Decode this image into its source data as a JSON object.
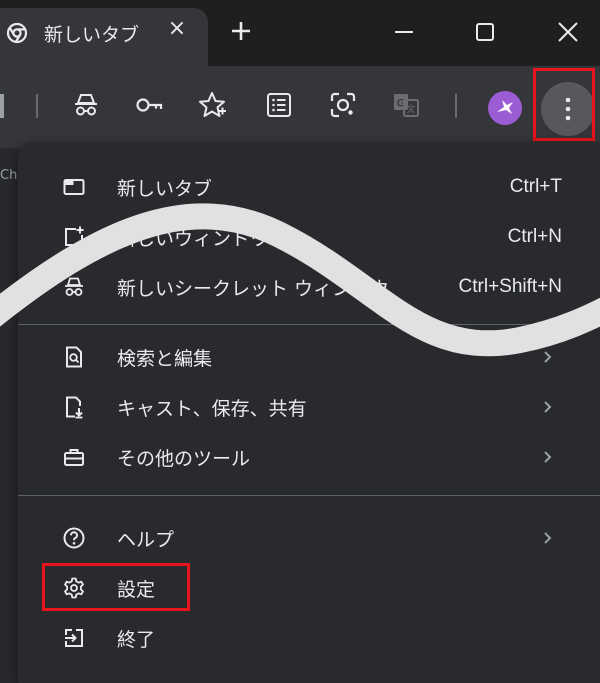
{
  "tab": {
    "title": "新しいタブ",
    "close_symbol": "×"
  },
  "page": {
    "left_text": "Ch"
  },
  "menu": {
    "group1": [
      {
        "label": "新しいタブ",
        "shortcut": "Ctrl+T",
        "icon": "new-tab-icon"
      },
      {
        "label": "新しいウィンドウ",
        "shortcut": "Ctrl+N",
        "icon": "new-window-icon"
      },
      {
        "label": "新しいシークレット ウィンドウ",
        "shortcut": "Ctrl+Shift+N",
        "icon": "incognito-icon"
      }
    ],
    "group2": [
      {
        "label": "検索と編集",
        "icon": "search-edit-icon"
      },
      {
        "label": "キャスト、保存、共有",
        "icon": "cast-save-share-icon"
      },
      {
        "label": "その他のツール",
        "icon": "more-tools-icon"
      }
    ],
    "group3": [
      {
        "label": "ヘルプ",
        "icon": "help-icon"
      },
      {
        "label": "設定",
        "icon": "gear-icon"
      },
      {
        "label": "終了",
        "icon": "exit-icon"
      }
    ]
  },
  "colors": {
    "highlight": "#e8141b",
    "menu_bg": "#292a2d",
    "toolbar_bg": "#35363a",
    "avatar": "#9c5cd4"
  }
}
